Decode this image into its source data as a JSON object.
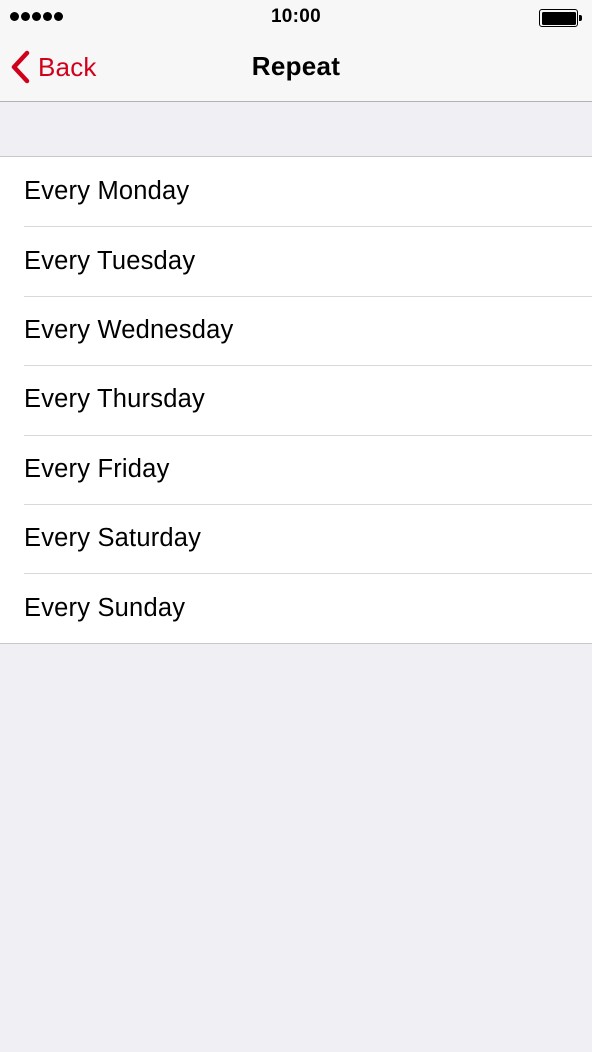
{
  "status_bar": {
    "time": "10:00",
    "signal_icon": "signal-dots-icon",
    "battery_icon": "battery-full-icon",
    "battery_level": 1.0
  },
  "nav": {
    "back_label": "Back",
    "back_icon": "chevron-left-icon",
    "title": "Repeat",
    "accent_color": "#d0021b"
  },
  "list": {
    "items": [
      {
        "label": "Every Monday"
      },
      {
        "label": "Every Tuesday"
      },
      {
        "label": "Every Wednesday"
      },
      {
        "label": "Every Thursday"
      },
      {
        "label": "Every Friday"
      },
      {
        "label": "Every Saturday"
      },
      {
        "label": "Every Sunday"
      }
    ]
  },
  "colors": {
    "background": "#efeff4",
    "separator": "#c8c7cc"
  }
}
